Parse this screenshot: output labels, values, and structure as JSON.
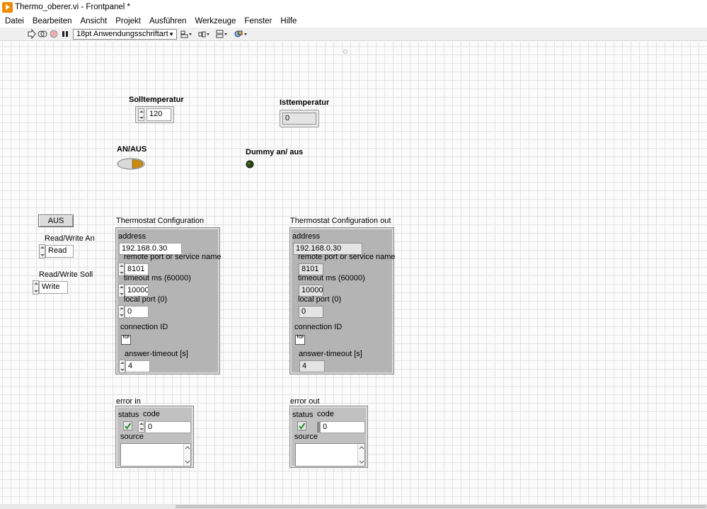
{
  "window": {
    "title": "Thermo_oberer.vi - Frontpanel *"
  },
  "menu": [
    "Datei",
    "Bearbeiten",
    "Ansicht",
    "Projekt",
    "Ausführen",
    "Werkzeuge",
    "Fenster",
    "Hilfe"
  ],
  "toolbar": {
    "font": "18pt Anwendungsschriftart"
  },
  "controls": {
    "solltemperatur": {
      "label": "Solltemperatur",
      "value": "120"
    },
    "isttemperatur": {
      "label": "Isttemperatur",
      "value": "0"
    },
    "an_aus": {
      "label": "AN/AUS"
    },
    "dummy": {
      "label": "Dummy an/ aus"
    },
    "aus_button": {
      "label": "AUS"
    },
    "rw_an": {
      "label": "Read/Write An",
      "value": "Read"
    },
    "rw_soll": {
      "label": "Read/Write Soll",
      "value": "Write"
    }
  },
  "config_in": {
    "title": "Thermostat Configuration",
    "address_label": "address",
    "address": "192.168.0.30",
    "port_label": "remote port or service name",
    "port": "8101",
    "timeout_label": "timeout ms (60000)",
    "timeout": "10000",
    "local_label": "local port (0)",
    "local": "0",
    "conn_label": "connection ID",
    "answer_label": "answer-timeout [s]",
    "answer": "4"
  },
  "config_out": {
    "title": "Thermostat Configuration out",
    "address_label": "address",
    "address": "192.168.0.30",
    "port_label": "remote port or service name",
    "port": "8101",
    "timeout_label": "timeout ms (60000)",
    "timeout": "10000",
    "local_label": "local port (0)",
    "local": "0",
    "conn_label": "connection ID",
    "answer_label": "answer-timeout [s]",
    "answer": "4"
  },
  "error_in": {
    "title": "error in",
    "status_label": "status",
    "code_label": "code",
    "code": "0",
    "source_label": "source"
  },
  "error_out": {
    "title": "error out",
    "status_label": "status",
    "code_label": "code",
    "code": "0",
    "source_label": "source"
  },
  "icons": {
    "app": "labview-play-icon",
    "tcp": "TCP"
  },
  "colors": {
    "led_on": "#c88a10",
    "led_dark": "#2d4a12",
    "check": "#1e8c1e"
  }
}
